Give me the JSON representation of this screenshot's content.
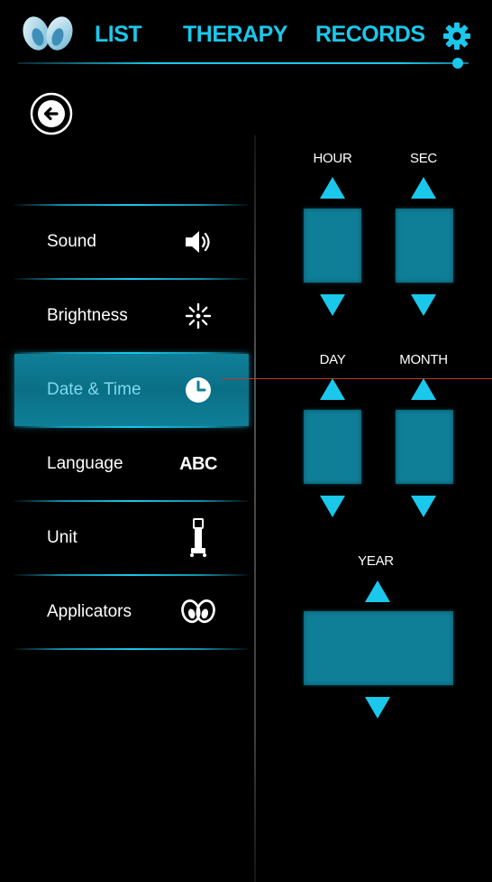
{
  "nav": {
    "list_label": "LIST",
    "therapy_label": "THERAPY",
    "records_label": "RECORDS",
    "logo_icon": "applicators-logo-icon",
    "settings_icon": "gear-icon"
  },
  "back_icon": "back-arrow-icon",
  "menu": {
    "items": [
      {
        "label": "Sound",
        "icon": "speaker-icon",
        "active": false
      },
      {
        "label": "Brightness",
        "icon": "brightness-icon",
        "active": false
      },
      {
        "label": "Date & Time",
        "icon": "clock-icon",
        "active": true
      },
      {
        "label": "Language",
        "icon": "abc-text-icon",
        "icon_text": "ABC",
        "active": false
      },
      {
        "label": "Unit",
        "icon": "unit-device-icon",
        "active": false
      },
      {
        "label": "Applicators",
        "icon": "applicators-icon",
        "active": false
      }
    ]
  },
  "pickers": {
    "hour_label": "HOUR",
    "sec_label": "SEC",
    "day_label": "DAY",
    "month_label": "MONTH",
    "year_label": "YEAR"
  },
  "colors": {
    "accent": "#1ac8ec",
    "active_fill": "#0f7f98",
    "background": "#000000",
    "indicator_line": "#c0392b"
  }
}
